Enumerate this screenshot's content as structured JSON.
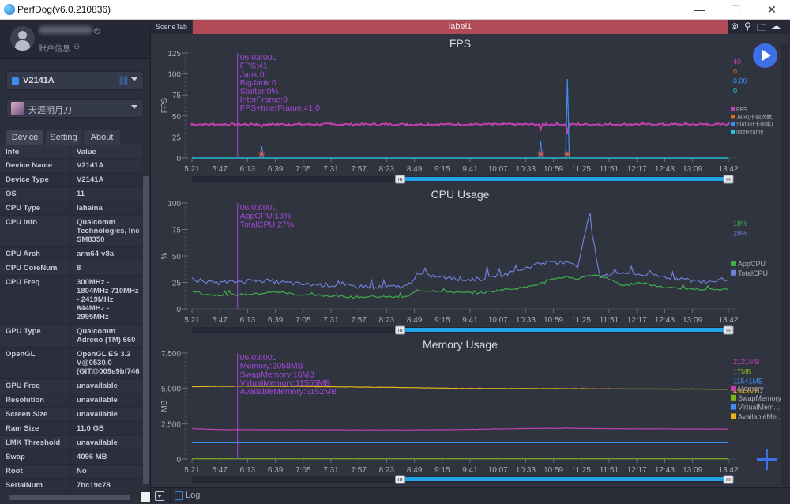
{
  "window": {
    "title": "PerfDog(v6.0.210836)",
    "controls": {
      "minimize": "—",
      "maximize": "☐",
      "close": "✕"
    }
  },
  "account": {
    "label": "账户信息",
    "power_icon": "⏻",
    "account_icon": "👤"
  },
  "device_selector": {
    "value": "V2141A",
    "link_icon": "🔗"
  },
  "app_selector": {
    "value": "天涯明月刀"
  },
  "tabs": [
    {
      "label": "Device",
      "active": true
    },
    {
      "label": "Setting",
      "active": false
    },
    {
      "label": "About",
      "active": false
    }
  ],
  "info_table": {
    "headers": [
      "Info",
      "Value"
    ],
    "rows": [
      [
        "Device Name",
        "V2141A"
      ],
      [
        "Device Type",
        "V2141A"
      ],
      [
        "OS",
        "11"
      ],
      [
        "CPU Type",
        "lahaina"
      ],
      [
        "CPU Info",
        "Qualcomm Technologies, Inc SM8350"
      ],
      [
        "CPU Arch",
        "arm64-v8a"
      ],
      [
        "CPU CoreNum",
        "8"
      ],
      [
        "CPU Freq",
        "300MHz - 1804MHz 710MHz - 2419MHz 844MHz - 2995MHz"
      ],
      [
        "GPU Type",
        "Qualcomm Adreno (TM) 660"
      ],
      [
        "OpenGL",
        "OpenGL ES 3.2 V@0530.0 (GIT@009e9bf746"
      ],
      [
        "GPU Freq",
        "unavailable"
      ],
      [
        "Resolution",
        "unavailable"
      ],
      [
        "Screen Size",
        "unavailable"
      ],
      [
        "Ram Size",
        "11.0 GB"
      ],
      [
        "LMK Threshold",
        "unavailable"
      ],
      [
        "Swap",
        "4096 MB"
      ],
      [
        "Root",
        "No"
      ],
      [
        "SerialNum",
        "7bc19c78"
      ]
    ]
  },
  "main": {
    "scene_tab": "SceneTab",
    "label_tab": "label1",
    "top_icons": [
      "location-pin-icon",
      "map-pin-icon",
      "folder-icon",
      "cloud-icon"
    ],
    "log": {
      "label": "Log",
      "checked": false
    }
  },
  "chart_data": [
    {
      "id": "fps",
      "type": "line",
      "title": "FPS",
      "ylabel": "FPS",
      "xlabel": "",
      "ylim": [
        0,
        125
      ],
      "yticks": [
        0,
        25,
        50,
        75,
        100,
        125
      ],
      "xticks": [
        "5:21",
        "5:47",
        "6:13",
        "6:39",
        "7:05",
        "7:31",
        "7:57",
        "8:23",
        "8:49",
        "9:15",
        "9:41",
        "10:07",
        "10:33",
        "10:59",
        "11:25",
        "11:51",
        "12:17",
        "12:43",
        "13:09",
        "13:42"
      ],
      "cursor": {
        "x_fraction": 0.085,
        "lines": [
          "06:03:000",
          "FPS:41",
          "Jank:0",
          "BigJank:0",
          "Stutter:0%",
          "InterFrame:0",
          "FPS+InterFrame:41.0"
        ]
      },
      "current_values": [
        {
          "text": "40",
          "color": "#c040b0"
        },
        {
          "text": "0",
          "color": "#e07020"
        },
        {
          "text": "0.00",
          "color": "#3a8ff0"
        },
        {
          "text": "0",
          "color": "#20c8d8"
        }
      ],
      "legend": [
        {
          "name": "FPS",
          "color": "#c040b0"
        },
        {
          "name": "Jank(卡顿次数)",
          "color": "#e07020"
        },
        {
          "name": "Stutter(卡顿率)",
          "color": "#3a8ff0"
        },
        {
          "name": "InterFrame",
          "color": "#20c8d8"
        }
      ],
      "series": [
        {
          "name": "FPS",
          "color": "#c040b0",
          "baseline": 40,
          "noise": 1.2,
          "dips": [
            [
              0.13,
              37
            ],
            [
              0.65,
              34
            ],
            [
              0.7,
              30
            ]
          ]
        },
        {
          "name": "Stutter",
          "color": "#3a8ff0",
          "baseline": 0,
          "noise": 0,
          "spikes": [
            [
              0.13,
              14
            ],
            [
              0.65,
              20
            ],
            [
              0.7,
              94
            ]
          ]
        },
        {
          "name": "InterFrame",
          "color": "#20c8d8",
          "baseline": 0,
          "noise": 0
        }
      ],
      "jank_markers": [
        0.13,
        0.65,
        0.7
      ],
      "range_slider": {
        "start_fraction": 0.39,
        "end_fraction": 1.0
      }
    },
    {
      "id": "cpu",
      "type": "line",
      "title": "CPU Usage",
      "ylabel": "%",
      "xlabel": "",
      "ylim": [
        0,
        100
      ],
      "yticks": [
        0,
        25,
        50,
        75,
        100
      ],
      "xticks": [
        "5:21",
        "5:47",
        "6:13",
        "6:39",
        "7:05",
        "7:31",
        "7:57",
        "8:23",
        "8:49",
        "9:15",
        "9:41",
        "10:07",
        "10:33",
        "10:59",
        "11:25",
        "11:51",
        "12:17",
        "12:43",
        "13:09",
        "13:42"
      ],
      "cursor": {
        "x_fraction": 0.085,
        "lines": [
          "06:03:000",
          "AppCPU:13%",
          "TotalCPU:27%"
        ]
      },
      "current_values": [
        {
          "text": "18%",
          "color": "#3fae49"
        },
        {
          "text": "28%",
          "color": "#6f7fd8"
        }
      ],
      "legend": [
        {
          "name": "AppCPU",
          "color": "#3fae49"
        },
        {
          "name": "TotalCPU",
          "color": "#6f7fd8"
        }
      ],
      "series": [
        {
          "name": "AppCPU",
          "color": "#3fae49",
          "points": [
            [
              0,
              17
            ],
            [
              0.02,
              14
            ],
            [
              0.04,
              13
            ],
            [
              0.08,
              13
            ],
            [
              0.12,
              14
            ],
            [
              0.16,
              16
            ],
            [
              0.2,
              13
            ],
            [
              0.26,
              12
            ],
            [
              0.3,
              11
            ],
            [
              0.36,
              11
            ],
            [
              0.4,
              11
            ],
            [
              0.42,
              17
            ],
            [
              0.46,
              17
            ],
            [
              0.5,
              15
            ],
            [
              0.54,
              15
            ],
            [
              0.58,
              18
            ],
            [
              0.62,
              20
            ],
            [
              0.66,
              25
            ],
            [
              0.68,
              29
            ],
            [
              0.7,
              30
            ],
            [
              0.72,
              28
            ],
            [
              0.74,
              32
            ],
            [
              0.78,
              28
            ],
            [
              0.8,
              22
            ],
            [
              0.84,
              24
            ],
            [
              0.88,
              20
            ],
            [
              0.92,
              19
            ],
            [
              0.96,
              18
            ],
            [
              1,
              18
            ]
          ]
        },
        {
          "name": "TotalCPU",
          "color": "#6f7fd8",
          "points": [
            [
              0,
              29
            ],
            [
              0.02,
              25
            ],
            [
              0.04,
              24
            ],
            [
              0.08,
              25
            ],
            [
              0.12,
              27
            ],
            [
              0.16,
              25
            ],
            [
              0.2,
              23
            ],
            [
              0.26,
              22
            ],
            [
              0.3,
              21
            ],
            [
              0.36,
              20
            ],
            [
              0.4,
              21
            ],
            [
              0.42,
              32
            ],
            [
              0.46,
              30
            ],
            [
              0.5,
              27
            ],
            [
              0.54,
              28
            ],
            [
              0.58,
              32
            ],
            [
              0.62,
              38
            ],
            [
              0.66,
              44
            ],
            [
              0.68,
              42
            ],
            [
              0.7,
              45
            ],
            [
              0.72,
              40
            ],
            [
              0.74,
              88
            ],
            [
              0.76,
              30
            ],
            [
              0.8,
              34
            ],
            [
              0.84,
              32
            ],
            [
              0.88,
              30
            ],
            [
              0.92,
              27
            ],
            [
              0.96,
              25
            ],
            [
              1,
              28
            ]
          ]
        }
      ],
      "range_slider": {
        "start_fraction": 0.39,
        "end_fraction": 1.0
      }
    },
    {
      "id": "memory",
      "type": "line",
      "title": "Memory Usage",
      "ylabel": "MB",
      "xlabel": "",
      "ylim": [
        0,
        7500
      ],
      "yticks": [
        0,
        2500,
        5000,
        7500
      ],
      "ytick_labels": [
        "0",
        "2,500",
        "5,000",
        "7,500"
      ],
      "xticks": [
        "5:21",
        "5:47",
        "6:13",
        "6:39",
        "7:05",
        "7:31",
        "7:57",
        "8:23",
        "8:49",
        "9:15",
        "9:41",
        "10:07",
        "10:33",
        "10:59",
        "11:25",
        "11:51",
        "12:17",
        "12:43",
        "13:09",
        "13:42"
      ],
      "cursor": {
        "x_fraction": 0.085,
        "lines": [
          "06:03:000",
          "Memory:2058MB",
          "SwapMemory:16MB",
          "VirtualMemory:11555MB",
          "AvailableMemory:5152MB"
        ]
      },
      "current_values": [
        {
          "text": "2121MB",
          "color": "#c040b0"
        },
        {
          "text": "17MB",
          "color": "#7ab51d"
        },
        {
          "text": "11541MB",
          "color": "#3a8ff0"
        },
        {
          "text": "4943MB",
          "color": "#e8b41c"
        }
      ],
      "legend": [
        {
          "name": "Memory",
          "color": "#c040b0"
        },
        {
          "name": "SwapMemory",
          "color": "#7ab51d"
        },
        {
          "name": "VirtualMem...",
          "color": "#3a8ff0"
        },
        {
          "name": "AvailableMe...",
          "color": "#e8b41c"
        }
      ],
      "series": [
        {
          "name": "Memory",
          "color": "#c040b0",
          "points": [
            [
              0,
              2150
            ],
            [
              0.05,
              2080
            ],
            [
              0.2,
              2070
            ],
            [
              0.4,
              2060
            ],
            [
              0.5,
              2080
            ],
            [
              0.6,
              2150
            ],
            [
              0.7,
              2180
            ],
            [
              0.8,
              2140
            ],
            [
              1,
              2121
            ]
          ]
        },
        {
          "name": "SwapMemory",
          "color": "#7ab51d",
          "points": [
            [
              0,
              16
            ],
            [
              1,
              17
            ]
          ]
        },
        {
          "name": "VirtualMemory",
          "color": "#3a8ff0",
          "points": [
            [
              0,
              1155
            ],
            [
              1,
              1154
            ]
          ]
        },
        {
          "name": "AvailableMemory",
          "color": "#e8b41c",
          "points": [
            [
              0,
              5120
            ],
            [
              0.1,
              5160
            ],
            [
              0.3,
              5100
            ],
            [
              0.4,
              5060
            ],
            [
              0.5,
              5000
            ],
            [
              0.6,
              4990
            ],
            [
              0.7,
              4980
            ],
            [
              0.8,
              4960
            ],
            [
              1,
              4943
            ]
          ]
        }
      ],
      "range_slider": {
        "start_fraction": 0.39,
        "end_fraction": 1.0
      }
    }
  ]
}
